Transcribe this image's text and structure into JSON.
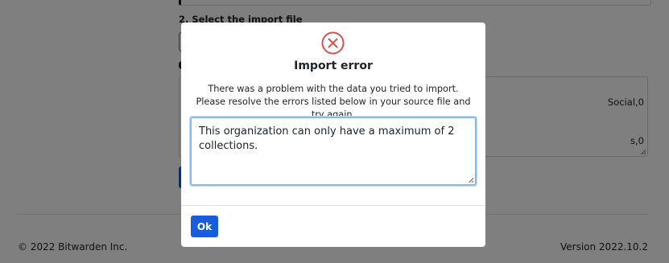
{
  "background": {
    "step_label": "2. Select the import file",
    "textarea_line_1": "Social,0",
    "textarea_line_2": "s,0",
    "footer_copyright": "© 2022 Bitwarden Inc.",
    "footer_version": "Version 2022.10.2"
  },
  "dialog": {
    "icon": "error-circle-x-icon",
    "icon_color": "#d9534f",
    "title": "Import error",
    "message": "There was a problem with the data you tried to import. Please resolve the errors listed below in your source file and try again.",
    "errors_text": "This organization can only have a maximum of 2 collections.",
    "ok_label": "Ok"
  },
  "colors": {
    "primary": "#175ddc",
    "error": "#d9534f",
    "focus_border": "#8bb9e8"
  }
}
